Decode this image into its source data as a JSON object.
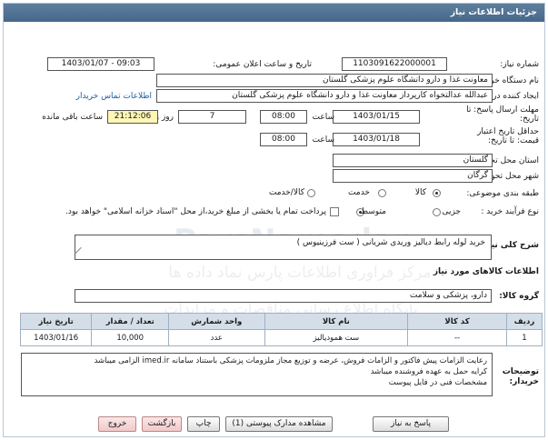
{
  "header": {
    "title": "جزئیات اطلاعات نیاز"
  },
  "form": {
    "need_number_label": "شماره نیاز:",
    "need_number": "1103091622000001",
    "announce_label": "تاریخ و ساعت اعلان عمومی:",
    "announce_value": "1403/01/07 - 09:03",
    "buyer_org_label": "نام دستگاه خریدار:",
    "buyer_org": "معاونت غذا و دارو دانشگاه علوم پزشکی گلستان",
    "creator_label": "ایجاد کننده درخواست:",
    "creator": "عبدالله عدالتخواه کارپرداز معاونت غذا و دارو دانشگاه علوم پزشکی گلستان",
    "contact_link": "اطلاعات تماس خریدار",
    "reply_deadline_label": "مهلت ارسال پاسخ: تا تاریخ:",
    "reply_date": "1403/01/15",
    "time_label": "ساعت",
    "reply_time": "08:00",
    "days_value": "7",
    "days_label": "روز و",
    "remaining_time": "21:12:06",
    "remaining_label": "ساعت باقی مانده",
    "validity_label": "حداقل تاریخ اعتبار قیمت: تا تاریخ:",
    "validity_date": "1403/01/18",
    "validity_time_label": "ساعت",
    "validity_time": "08:00",
    "province_label": "استان محل تحویل:",
    "province": "گلستان",
    "city_label": "شهر محل تحویل:",
    "city": "گرگان",
    "category_label": "طبقه بندی موضوعی:",
    "category_options": [
      "کالا",
      "خدمت",
      "کالا/خدمت"
    ],
    "category_selected": 0,
    "process_label": "نوع فرآیند خرید :",
    "process_options": [
      "جزیی",
      "متوسط"
    ],
    "process_selected": 1,
    "payment_note": "پرداخت تمام یا بخشی از مبلغ خرید،از محل \"اسناد خزانه اسلامی\" خواهد بود."
  },
  "description": {
    "label": "شرح کلی نیاز:",
    "value": "خرید لوله رابط دیالیز وریدی شریانی ( ست فرزینیوس )"
  },
  "goods": {
    "section_title": "اطلاعات کالاهای مورد نیاز",
    "group_label": "گروه کالا:",
    "group_value": "دارو، پزشکی و سلامت",
    "columns": [
      "ردیف",
      "کد کالا",
      "نام کالا",
      "واحد شمارش",
      "تعداد / مقدار",
      "تاریخ نیاز"
    ],
    "rows": [
      [
        "1",
        "--",
        "ست همودیالیز",
        "عدد",
        "10,000",
        "1403/01/16"
      ]
    ]
  },
  "buyer_notes": {
    "label": "توضیحات خریدار:",
    "lines": [
      "رعایت الزامات پیش فاکتور و الزامات فروش، عرضه و توزیع مجاز ملزومات پزشکی باستناد سامانه imed.ir الزامی میباشد",
      "کرایه حمل به عهده فروشنده میباشد",
      "مشخصات فنی  در فایل پیوست"
    ]
  },
  "buttons": {
    "reply": "پاسخ به نیاز",
    "attachments": "مشاهده مدارک پیوستی (1)",
    "print": "چاپ",
    "back": "بازگشت",
    "exit": "خروج"
  },
  "watermark": {
    "brand": "ParsNamadar",
    "line1": "مرکز فراوری اطلاعات پارس نماد داده ها",
    "line2": "پایگاه اطلاع رسانی مناقصات و مزایدات"
  }
}
